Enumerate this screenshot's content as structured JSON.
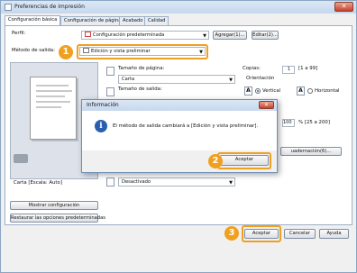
{
  "window": {
    "title": "Preferencias de impresión",
    "close": "✕"
  },
  "tabs": [
    "Configuración básica",
    "Configuración de página",
    "Acabado",
    "Calidad"
  ],
  "profile": {
    "label": "Perfil:",
    "value": "Configuración predeterminada",
    "add": "Agregar(1)...",
    "edit": "Editar(2)..."
  },
  "output": {
    "label": "Método de salida:",
    "value": "Edición y vista preliminar"
  },
  "page_size": {
    "label": "Tamaño de página:",
    "value": "Carta"
  },
  "output_size": {
    "label": "Tamaño de salida:"
  },
  "copies": {
    "label": "Copias:",
    "value": "1",
    "range": "[1 a 99]"
  },
  "orientation": {
    "label": "Orientación",
    "vertical": "Vertical",
    "horizontal": "Horizontal"
  },
  "zoom": {
    "value": "100",
    "range": "% [25 a 200]"
  },
  "binding_button": "uadernación(6)...",
  "duplex": {
    "value": "Desactivado"
  },
  "preview": {
    "caption": "Carta [Escala: Auto]"
  },
  "side_buttons": {
    "show_config": "Mostrar configuración",
    "restore_defaults": "Restaurar las opciones predeterminadas"
  },
  "footer": {
    "accept": "Aceptar",
    "cancel": "Cancelar",
    "help": "Ayuda"
  },
  "dialog": {
    "title": "Información",
    "message": "El método de salida cambiará a [Edición y vista preliminar].",
    "accept": "Aceptar",
    "close": "✕"
  },
  "callouts": [
    "1",
    "2",
    "3"
  ],
  "colors": {
    "callout": "#f0a020",
    "titlebar": "#c6d8ee"
  }
}
